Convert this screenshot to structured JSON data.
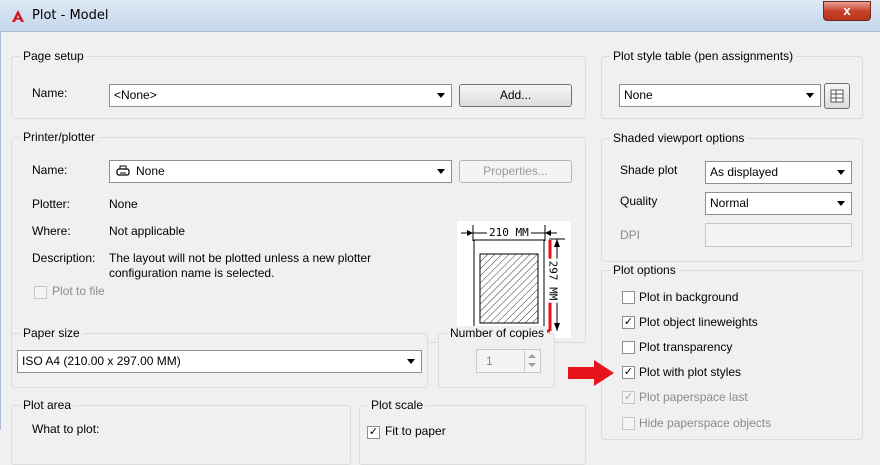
{
  "window": {
    "title": "Plot - Model",
    "close_glyph": "x",
    "app_icon": "autocad-logo-icon"
  },
  "page_setup": {
    "group_title": "Page setup",
    "name_label": "Name:",
    "name_value": "<None>",
    "add_button": "Add..."
  },
  "printer": {
    "group_title": "Printer/plotter",
    "name_label": "Name:",
    "name_value": "None",
    "properties_button": "Properties...",
    "plotter_label": "Plotter:",
    "plotter_value": "None",
    "where_label": "Where:",
    "where_value": "Not applicable",
    "description_label": "Description:",
    "description_line1": "The layout will not be plotted unless a new plotter",
    "description_line2": "configuration name is selected.",
    "plot_to_file": "Plot to file",
    "preview_width": "210 MM",
    "preview_height": "297 MM"
  },
  "paper_size": {
    "group_title": "Paper size",
    "value": "ISO A4 (210.00 x 297.00 MM)"
  },
  "copies": {
    "group_title": "Number of copies",
    "value": "1"
  },
  "plot_area": {
    "group_title": "Plot area",
    "what_to_plot": "What to plot:"
  },
  "plot_scale": {
    "group_title": "Plot scale",
    "fit_label": "Fit to paper"
  },
  "plot_style_table": {
    "group_title": "Plot style table (pen assignments)",
    "value": "None",
    "edit_icon": "edit-table-icon"
  },
  "shaded_viewport": {
    "group_title": "Shaded viewport options",
    "shade_plot_label": "Shade plot",
    "shade_plot_value": "As displayed",
    "quality_label": "Quality",
    "quality_value": "Normal",
    "dpi_label": "DPI"
  },
  "plot_options": {
    "group_title": "Plot options",
    "items": [
      {
        "label": "Plot in background",
        "checked": false,
        "disabled": false
      },
      {
        "label": "Plot object lineweights",
        "checked": true,
        "disabled": false
      },
      {
        "label": "Plot transparency",
        "checked": false,
        "disabled": false
      },
      {
        "label": "Plot with plot styles",
        "checked": true,
        "disabled": false
      },
      {
        "label": "Plot paperspace last",
        "checked": true,
        "disabled": true
      },
      {
        "label": "Hide paperspace objects",
        "checked": false,
        "disabled": true
      }
    ]
  },
  "annotation": {
    "arrow_color": "#e8141c"
  }
}
